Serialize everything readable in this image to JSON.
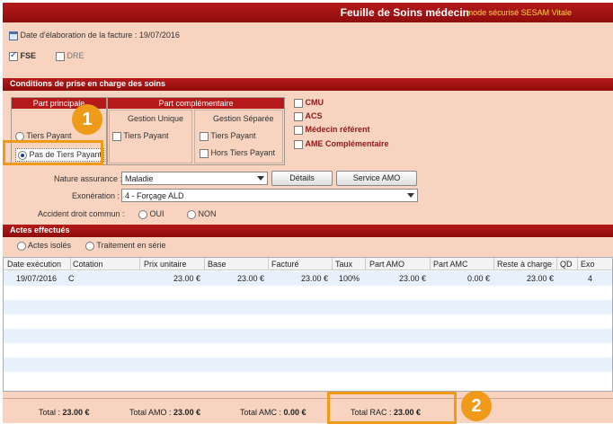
{
  "window": {
    "title": "Feuille de Soins médecin",
    "subtitle": "mode sécurisé SESAM Vitale"
  },
  "invoice": {
    "date_label": "Date d'élaboration de la facture : 19/07/2016",
    "fse_label": "FSE",
    "dre_label": "DRE",
    "fse_checked": true,
    "dre_checked": false
  },
  "conditions": {
    "header": "Conditions de prise en charge des soins",
    "part_principale": {
      "title": "Part principale",
      "tiers_payant": "Tiers Payant",
      "pas_tiers_payant": "Pas de Tiers Payant",
      "selected": "pas_tiers_payant"
    },
    "part_complementaire": {
      "title": "Part complémentaire",
      "gestion_unique": "Gestion Unique",
      "gestion_separee": "Gestion Séparée",
      "gu_tiers_payant": "Tiers Payant",
      "gs_tiers_payant": "Tiers Payant",
      "gs_hors_tiers_payant": "Hors Tiers Payant"
    },
    "options": {
      "cmu": "CMU",
      "acs": "ACS",
      "medecin_referent": "Médecin référent",
      "ame": "AME Complémentaire"
    },
    "nature_assurance_label": "Nature assurance :",
    "nature_assurance_value": "Maladie",
    "details_button": "Détails",
    "service_amo_button": "Service AMO",
    "exoneration_label": "Exonération :",
    "exoneration_value": "4 - Forçage ALD",
    "accident_label": "Accident droit commun :",
    "oui": "OUI",
    "non": "NON"
  },
  "actes": {
    "header": "Actes effectués",
    "actes_isoles": "Actes isolés",
    "traitement_serie": "Traitement en série",
    "columns": [
      "Date exécution",
      "Cotation",
      "Prix unitaire",
      "Base",
      "Facturé",
      "Taux",
      "Part AMO",
      "Part AMC",
      "Reste à charge",
      "QD",
      "Exo"
    ],
    "rows": [
      {
        "date": "19/07/2016",
        "cotation": "C",
        "prix": "23.00 €",
        "base": "23.00 €",
        "facture": "23.00 €",
        "taux": "100%",
        "amo": "23.00 €",
        "amc": "0.00 €",
        "rac": "23.00 €",
        "qd": "",
        "exo": "4"
      }
    ]
  },
  "totals": {
    "total_label": "Total :",
    "total_value": "23.00 €",
    "amo_label": "Total AMO :",
    "amo_value": "23.00 €",
    "amc_label": "Total AMC :",
    "amc_value": "0.00 €",
    "rac_label": "Total RAC :",
    "rac_value": "23.00 €"
  },
  "annotations": {
    "badge1": "1",
    "badge2": "2",
    "color": "#ef9a19"
  }
}
